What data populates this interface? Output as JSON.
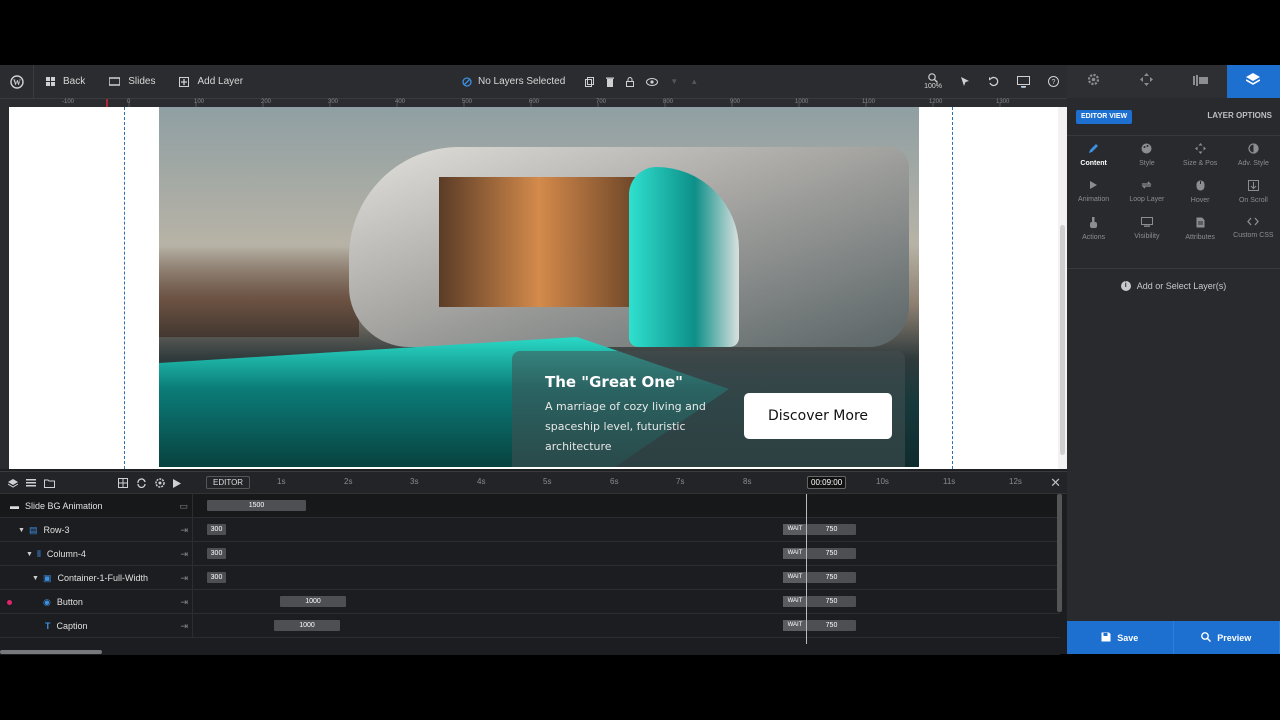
{
  "toolbar": {
    "back_label": "Back",
    "slides_label": "Slides",
    "add_layer_label": "Add Layer",
    "selection_status": "No Layers Selected",
    "zoom": "100%"
  },
  "ruler": {
    "ticks": [
      "-100",
      "0",
      "100",
      "200",
      "300",
      "400",
      "500",
      "600",
      "700",
      "800",
      "900",
      "1000",
      "1100",
      "1200",
      "1300"
    ]
  },
  "slide": {
    "title": "The \"Great One\"",
    "text": "A marriage of cozy living and spaceship level, futuristic architecture",
    "button_label": "Discover More"
  },
  "timeline": {
    "editor_label": "EDITOR",
    "ticks": [
      "1s",
      "2s",
      "3s",
      "4s",
      "5s",
      "6s",
      "7s",
      "8s",
      "10s",
      "11s",
      "12s"
    ],
    "current_time": "00:09:00",
    "rows": [
      {
        "name": "Slide BG Animation",
        "bar": "1500"
      },
      {
        "name": "Row-3",
        "bar": "300",
        "wait": "WAIT",
        "end": "750"
      },
      {
        "name": "Column-4",
        "bar": "300",
        "wait": "WAIT",
        "end": "750"
      },
      {
        "name": "Container-1-Full-Width",
        "bar": "300",
        "wait": "WAIT",
        "end": "750"
      },
      {
        "name": "Button",
        "bar": "1000",
        "wait": "WAIT",
        "end": "750"
      },
      {
        "name": "Caption",
        "bar": "1000",
        "wait": "WAIT",
        "end": "750"
      }
    ]
  },
  "panel": {
    "editor_view": "EDITOR VIEW",
    "layer_options": "LAYER OPTIONS",
    "items": [
      "Content",
      "Style",
      "Size & Pos",
      "Adv. Style",
      "Animation",
      "Loop Layer",
      "Hover",
      "On Scroll",
      "Actions",
      "Visibility",
      "Attributes",
      "Custom CSS"
    ],
    "hint": "Add or Select Layer(s)",
    "save_label": "Save",
    "preview_label": "Preview"
  },
  "colors": {
    "accent": "#1d6fd0",
    "toolbar_bg": "#2b2c2f",
    "panel_bg": "#292a2d"
  }
}
